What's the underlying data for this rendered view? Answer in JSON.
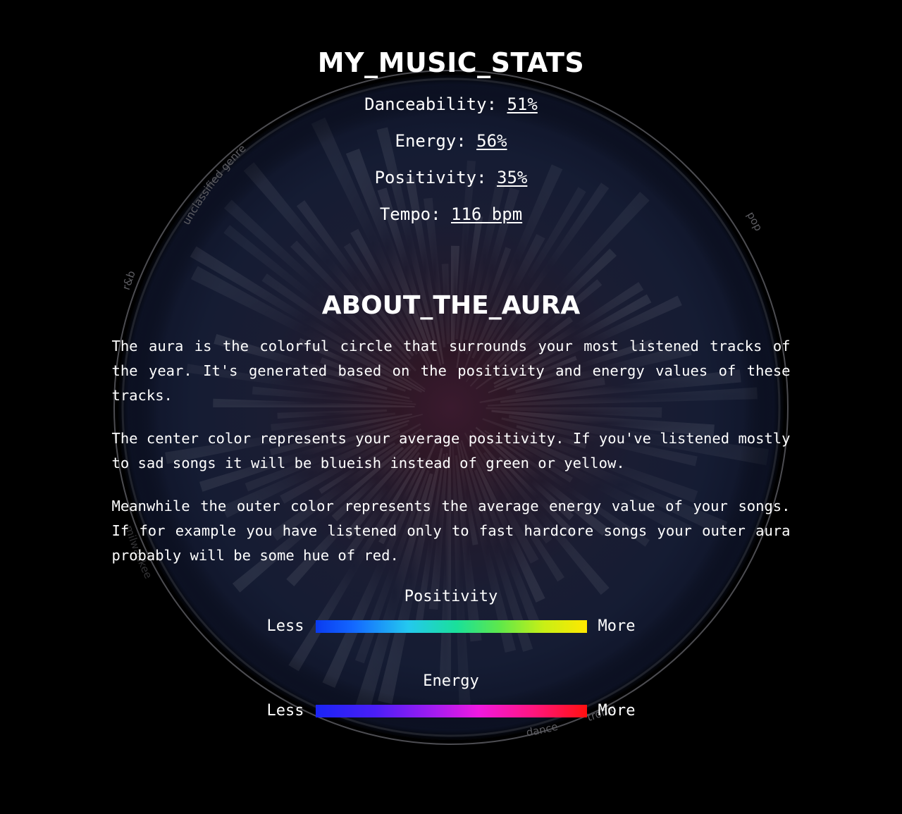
{
  "header": {
    "title": "MY_MUSIC_STATS"
  },
  "stats": [
    {
      "label": "Danceability:",
      "value": "51%",
      "name": "danceability"
    },
    {
      "label": "Energy:",
      "value": "56%",
      "name": "energy"
    },
    {
      "label": "Positivity:",
      "value": "35%",
      "name": "positivity"
    },
    {
      "label": "Tempo:",
      "value": "116 bpm",
      "name": "tempo"
    }
  ],
  "about": {
    "title": "ABOUT_THE_AURA",
    "paragraphs": [
      "The aura is the colorful circle that surrounds your most listened tracks of the year. It's generated based on the positivity and energy values of these tracks.",
      "The center color represents your average positivity. If you've listened mostly to sad songs it will be blueish instead of green or yellow.",
      "Meanwhile the outer color represents the average energy value of your songs. If for example you have listened only to fast hardcore songs your outer aura probably will be some hue of red."
    ]
  },
  "legends": [
    {
      "caption": "Positivity",
      "less_label": "Less",
      "more_label": "More",
      "bar_name": "positivity-gradient-bar",
      "gradient_stops": [
        "#0a3bf0",
        "#24c8ef",
        "#1ae09a",
        "#c8ef16",
        "#ffe800"
      ]
    },
    {
      "caption": "Energy",
      "less_label": "Less",
      "more_label": "More",
      "bar_name": "energy-gradient-bar",
      "gradient_stops": [
        "#1a24f5",
        "#a51cf0",
        "#ef19e0",
        "#ff1680",
        "#ff1010"
      ]
    }
  ],
  "aura": {
    "genre_labels": [
      {
        "text": "unclassified genre",
        "name": "genre-label-unclassified-genre"
      },
      {
        "text": "r&b",
        "name": "genre-label-rnb"
      },
      {
        "text": "pop",
        "name": "genre-label-pop"
      },
      {
        "text": "dance",
        "name": "genre-label-dance"
      },
      {
        "text": "tronic",
        "name": "genre-label-tronic"
      },
      {
        "text": "milwaukee",
        "name": "genre-label-milwaukee"
      }
    ],
    "center_color": "#2a1524",
    "outer_color": "#141b33",
    "ring_color": "#6f7076",
    "background_color": "#000000"
  }
}
